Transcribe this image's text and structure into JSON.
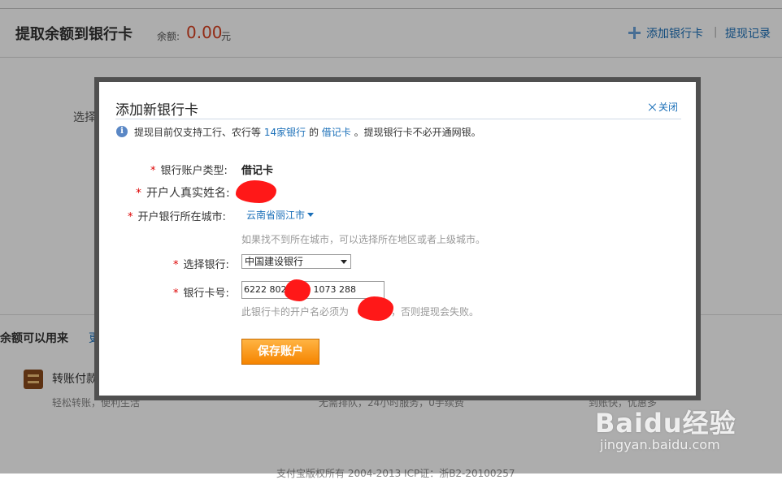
{
  "header": {
    "title": "提取余额到银行卡",
    "balance_label": "余额:",
    "balance_value": "0.00",
    "balance_unit": "元",
    "add_card_link": "添加银行卡",
    "separator": "|",
    "record_link": "提现记录"
  },
  "background": {
    "select_label": "选择",
    "section_title": "余额可以用来",
    "section_link": "更",
    "transfer_title": "转账付款",
    "transfer_desc": "轻松转账，便利生活",
    "mid_desc": "无需排队，24小时服务，0手续费",
    "right_desc": "到账快，优惠多",
    "footer": "支付宝版权所有 2004-2013 ICP证：浙B2-20100257"
  },
  "dialog": {
    "title": "添加新银行卡",
    "close_label": "关闭",
    "info": {
      "prefix": "提现目前仅支持工行、农行等",
      "banks_link": "14家银行",
      "mid": "的",
      "debit_link": "借记卡",
      "suffix": "。提现银行卡不必开通网银。"
    },
    "required_mark": "*",
    "account_type_label": "银行账户类型:",
    "account_type_value": "借记卡",
    "real_name_label": "开户人真实姓名:",
    "city_label": "开户银行所在城市:",
    "city_value": "云南省丽江市",
    "city_hint": "如果找不到所在城市，可以选择所在地区或者上级城市。",
    "bank_label": "选择银行:",
    "bank_value": "中国建设银行",
    "card_label": "银行卡号:",
    "card_value_start": "6222 8028",
    "card_value_end": "1073 288",
    "card_warning_prefix": "此银行卡的开户名必须为",
    "card_warning_suffix": "，否则提现会失败。",
    "save_button": "保存账户"
  },
  "watermark": {
    "logo": "Baidu经验",
    "sub": "jingyan.baidu.com"
  },
  "colors": {
    "accent_link": "#1a6fb8",
    "balance": "#d7401f",
    "save_button": "#f58400",
    "redaction": "#ff1818"
  }
}
